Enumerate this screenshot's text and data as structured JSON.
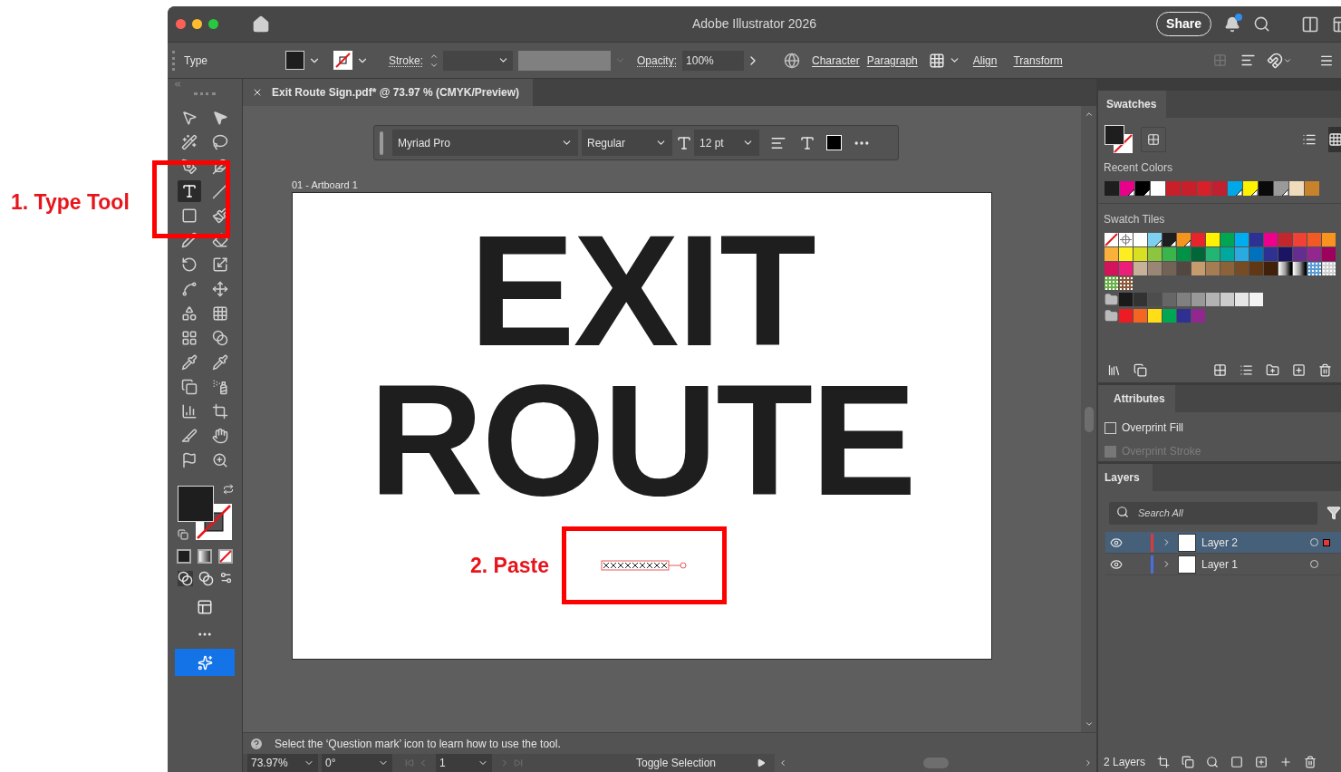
{
  "annotations": {
    "type_tool": "1. Type Tool",
    "paste": "2. Paste"
  },
  "window": {
    "title": "Adobe Illustrator 2026",
    "share": "Share",
    "notification": true
  },
  "control_bar": {
    "tool": "Type",
    "stroke_label": "Stroke:",
    "opacity_label": "Opacity:",
    "opacity": "100%",
    "text_links": [
      "Character",
      "Paragraph"
    ],
    "panel_links": [
      "Align",
      "Transform"
    ]
  },
  "document": {
    "tab_title": "Exit Route Sign.pdf* @ 73.97 % (CMYK/Preview)"
  },
  "type_bar": {
    "font": "Myriad Pro",
    "style": "Regular",
    "size": "12 pt"
  },
  "artboard": {
    "label": "01 - Artboard 1",
    "lines": [
      "EXIT",
      "ROUTE"
    ]
  },
  "tools": [
    {
      "selected": false
    },
    {
      "selected": false
    },
    {
      "selected": false
    },
    {
      "selected": false
    },
    {
      "selected": false
    },
    {
      "selected": false
    },
    {
      "selected": true
    },
    {
      "selected": false
    },
    {
      "selected": false
    },
    {
      "selected": false
    },
    {
      "selected": false
    },
    {
      "selected": false
    },
    {
      "selected": false
    },
    {
      "selected": false
    },
    {
      "selected": false
    },
    {
      "selected": false
    },
    {
      "selected": false
    },
    {
      "selected": false
    },
    {
      "selected": false
    },
    {
      "selected": false
    },
    {
      "selected": false
    },
    {
      "selected": false
    },
    {
      "selected": false
    },
    {
      "selected": false
    },
    {
      "selected": false
    },
    {
      "selected": false
    },
    {
      "selected": false
    },
    {
      "selected": false
    },
    {
      "selected": false
    },
    {
      "selected": false
    }
  ],
  "hint": "Select the ‘Question mark’ icon to learn how to use the tool.",
  "status": {
    "zoom": "73.97%",
    "rotation": "0°",
    "artboard": "1",
    "mode": "Toggle Selection"
  },
  "swatches": {
    "title": "Swatches",
    "recent_label": "Recent Colors",
    "tiles_label": "Swatch Tiles",
    "recent": [
      {
        "color": "#1e1e1e",
        "global": false
      },
      {
        "color": "#e6008a",
        "global": true
      },
      {
        "color": "#000000",
        "global": true
      },
      {
        "color": "#ffffff",
        "global": false
      },
      {
        "color": "#c8202a",
        "global": false
      },
      {
        "color": "#c8202a",
        "global": false
      },
      {
        "color": "#d8202a",
        "global": false
      },
      {
        "color": "#c02030",
        "global": false
      },
      {
        "color": "#00a8e8",
        "global": true
      },
      {
        "color": "#fff200",
        "global": true
      },
      {
        "color": "#0a0a0a",
        "global": false
      },
      {
        "color": "#9a9a9a",
        "global": true
      },
      {
        "color": "#f0dcbc",
        "global": false
      },
      {
        "color": "#c8822a",
        "global": false
      }
    ],
    "groups": [
      {
        "folder": false,
        "items": [
          {
            "kind": "none"
          },
          {
            "kind": "registration"
          },
          {
            "kind": "color",
            "color": "#ffffff",
            "global": false
          },
          {
            "kind": "color",
            "color": "#7fcff0",
            "global": true
          },
          {
            "kind": "color",
            "color": "#1e1e1e",
            "global": true
          },
          {
            "kind": "color",
            "color": "#f7941d",
            "global": true
          },
          {
            "kind": "color",
            "color": "#e8232a",
            "global": false
          },
          {
            "kind": "color",
            "color": "#fff200",
            "global": false
          },
          {
            "kind": "color",
            "color": "#00a651",
            "global": false
          },
          {
            "kind": "color",
            "color": "#00aeef",
            "global": false
          },
          {
            "kind": "color",
            "color": "#2e3192",
            "global": false
          },
          {
            "kind": "color",
            "color": "#ec008c",
            "global": false
          },
          {
            "kind": "color",
            "color": "#c1272d",
            "global": false
          },
          {
            "kind": "color",
            "color": "#ef4136",
            "global": false
          },
          {
            "kind": "color",
            "color": "#f15a24",
            "global": false
          },
          {
            "kind": "color",
            "color": "#f7931e",
            "global": false
          },
          {
            "kind": "color",
            "color": "#fbb03b",
            "global": false
          },
          {
            "kind": "color",
            "color": "#fcee21",
            "global": false
          },
          {
            "kind": "color",
            "color": "#d9e021",
            "global": false
          },
          {
            "kind": "color",
            "color": "#8cc63f",
            "global": false
          },
          {
            "kind": "color",
            "color": "#39b54a",
            "global": false
          },
          {
            "kind": "color",
            "color": "#009245",
            "global": false
          },
          {
            "kind": "color",
            "color": "#006837",
            "global": false
          },
          {
            "kind": "color",
            "color": "#22b573",
            "global": false
          },
          {
            "kind": "color",
            "color": "#00a99d",
            "global": false
          },
          {
            "kind": "color",
            "color": "#29abe2",
            "global": false
          },
          {
            "kind": "color",
            "color": "#0071bc",
            "global": false
          },
          {
            "kind": "color",
            "color": "#2e3192",
            "global": false
          },
          {
            "kind": "color",
            "color": "#1b1464",
            "global": false
          },
          {
            "kind": "color",
            "color": "#662d91",
            "global": false
          },
          {
            "kind": "color",
            "color": "#93278f",
            "global": false
          },
          {
            "kind": "color",
            "color": "#9e005d",
            "global": false
          },
          {
            "kind": "color",
            "color": "#d4145a",
            "global": false
          },
          {
            "kind": "color",
            "color": "#ed1e79",
            "global": false
          },
          {
            "kind": "color",
            "color": "#c7b299",
            "global": false
          },
          {
            "kind": "color",
            "color": "#998675",
            "global": false
          },
          {
            "kind": "color",
            "color": "#736357",
            "global": false
          },
          {
            "kind": "color",
            "color": "#534741",
            "global": false
          },
          {
            "kind": "color",
            "color": "#c69c6d",
            "global": false
          },
          {
            "kind": "color",
            "color": "#a67c52",
            "global": false
          },
          {
            "kind": "color",
            "color": "#8c6239",
            "global": false
          },
          {
            "kind": "color",
            "color": "#754c24",
            "global": false
          },
          {
            "kind": "color",
            "color": "#603813",
            "global": false
          },
          {
            "kind": "color",
            "color": "#42210b",
            "global": false
          },
          {
            "kind": "gradient"
          },
          {
            "kind": "gradient"
          },
          {
            "kind": "pattern",
            "color": "#5b9bd5"
          },
          {
            "kind": "pattern",
            "color": "#d0d0d0"
          },
          {
            "kind": "pattern",
            "color": "#6ab04c"
          },
          {
            "kind": "pattern",
            "color": "#8b5a3c"
          }
        ]
      },
      {
        "folder": true,
        "items": [
          {
            "kind": "color",
            "color": "#1a1a1a",
            "global": false
          },
          {
            "kind": "color",
            "color": "#333333",
            "global": false
          },
          {
            "kind": "color",
            "color": "#4d4d4d",
            "global": false
          },
          {
            "kind": "color",
            "color": "#666666",
            "global": false
          },
          {
            "kind": "color",
            "color": "#808080",
            "global": false
          },
          {
            "kind": "color",
            "color": "#999999",
            "global": false
          },
          {
            "kind": "color",
            "color": "#b3b3b3",
            "global": false
          },
          {
            "kind": "color",
            "color": "#cccccc",
            "global": false
          },
          {
            "kind": "color",
            "color": "#e6e6e6",
            "global": false
          },
          {
            "kind": "color",
            "color": "#f2f2f2",
            "global": false
          }
        ]
      },
      {
        "folder": true,
        "items": [
          {
            "kind": "color",
            "color": "#ed1c24",
            "global": false
          },
          {
            "kind": "color",
            "color": "#f26522",
            "global": false
          },
          {
            "kind": "color",
            "color": "#ffde17",
            "global": false
          },
          {
            "kind": "color",
            "color": "#00a651",
            "global": false
          },
          {
            "kind": "color",
            "color": "#2e3192",
            "global": false
          },
          {
            "kind": "color",
            "color": "#92278f",
            "global": false
          }
        ]
      }
    ]
  },
  "attributes": {
    "title": "Attributes",
    "options": [
      {
        "label": "Overprint Fill",
        "checked": false,
        "disabled": false
      },
      {
        "label": "Overprint Stroke",
        "checked": false,
        "disabled": true
      }
    ]
  },
  "layers": {
    "title": "Layers",
    "search_placeholder": "Search All",
    "count": "2 Layers",
    "items": [
      {
        "name": "Layer 2",
        "color": "#e0393b",
        "selected": true,
        "visible": true
      },
      {
        "name": "Layer 1",
        "color": "#4a6ee0",
        "selected": false,
        "visible": true
      }
    ]
  }
}
